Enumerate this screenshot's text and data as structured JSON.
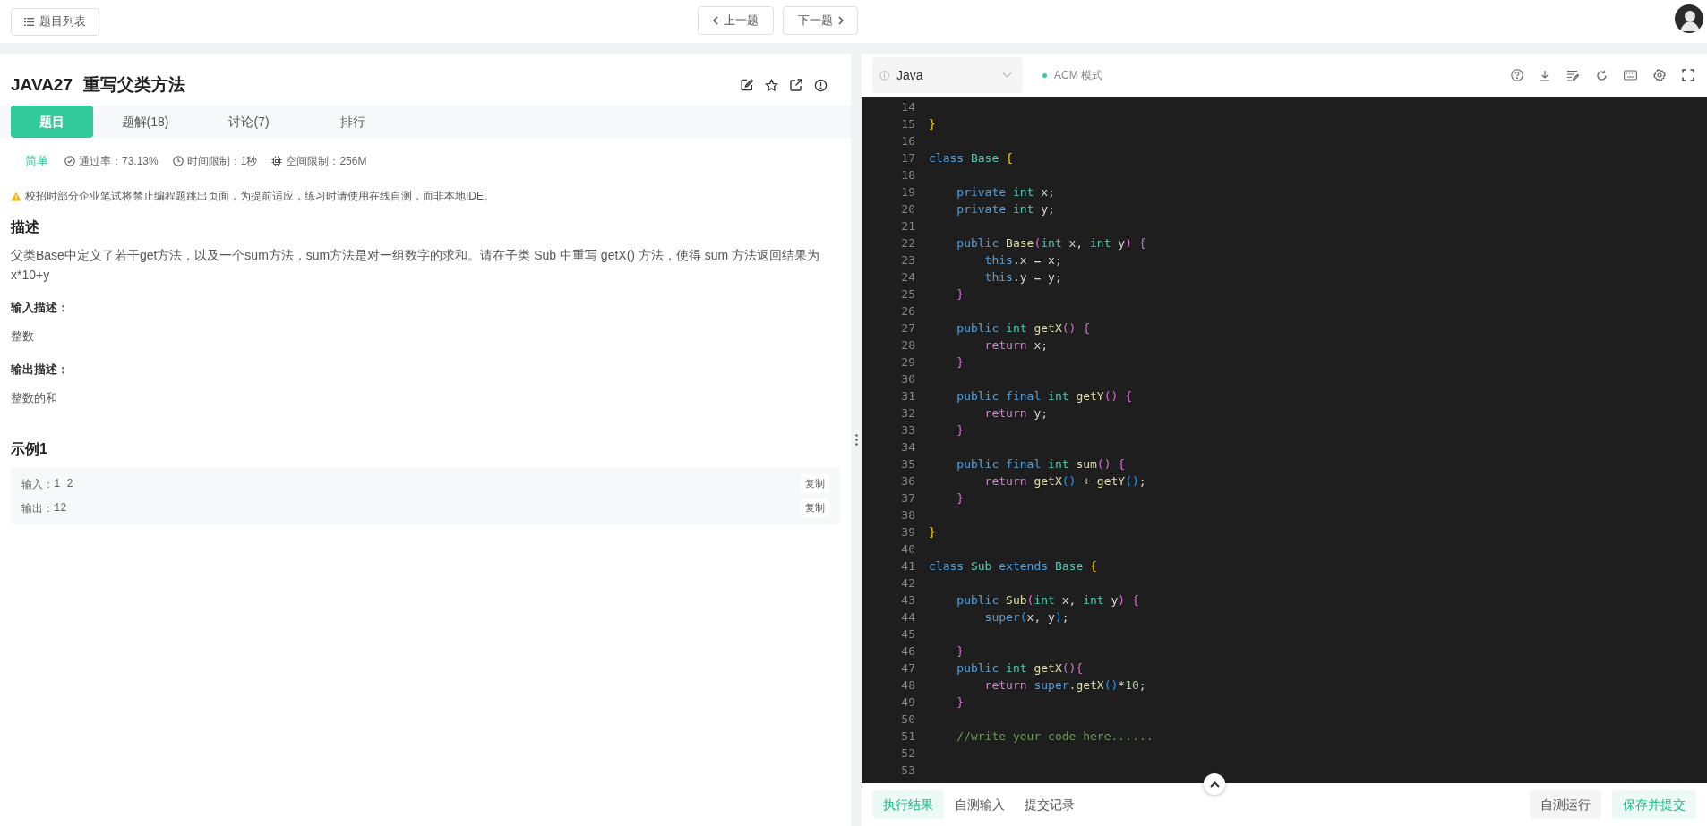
{
  "top_bar": {
    "problem_list_button": "题目列表",
    "prev_button": "上一题",
    "next_button": "下一题"
  },
  "problem": {
    "code": "JAVA27",
    "title": "重写父类方法",
    "tabs": [
      {
        "label": "题目",
        "selected": true
      },
      {
        "label": "题解(18)",
        "selected": false
      },
      {
        "label": "讨论(7)",
        "selected": false
      },
      {
        "label": "排行",
        "selected": false
      }
    ],
    "difficulty": "简单",
    "pass_rate": "通过率：73.13%",
    "time_limit": "时间限制：1秒",
    "memory_limit": "空间限制：256M",
    "notice": "校招时部分企业笔试将禁止编程题跳出页面，为提前适应，练习时请使用在线自测，而非本地IDE。",
    "description": {
      "heading": "描述",
      "text": "父类Base中定义了若干get方法，以及一个sum方法，sum方法是对一组数字的求和。请在子类 Sub 中重写 getX() 方法，使得 sum 方法返回结果为 x*10+y"
    },
    "input_description": {
      "heading": "输入描述：",
      "text": "整数"
    },
    "output_description": {
      "heading": "输出描述：",
      "text": "整数的和"
    },
    "example": {
      "title": "示例1",
      "rows": [
        {
          "label": "输入：",
          "value": "1 2",
          "copy": "复制"
        },
        {
          "label": "输出：",
          "value": "12",
          "copy": "复制"
        }
      ]
    }
  },
  "editor": {
    "language": "Java",
    "mode": "ACM 模式",
    "lines": [
      {
        "number": "14"
      },
      {
        "number": "15",
        "tokens": [
          {
            "kind": "brace1",
            "text": "}"
          }
        ]
      },
      {
        "number": "16"
      },
      {
        "number": "17",
        "tokens": [
          {
            "kind": "keyword",
            "text": "class "
          },
          {
            "kind": "type",
            "text": "Base "
          },
          {
            "kind": "brace1",
            "text": "{"
          }
        ]
      },
      {
        "number": "18"
      },
      {
        "number": "19",
        "tokens": [
          {
            "kind": "keyword",
            "text": "    private "
          },
          {
            "kind": "type",
            "text": "int"
          },
          {
            "kind": "plain",
            "text": " x;"
          }
        ]
      },
      {
        "number": "20",
        "tokens": [
          {
            "kind": "keyword",
            "text": "    private "
          },
          {
            "kind": "type",
            "text": "int"
          },
          {
            "kind": "plain",
            "text": " y;"
          }
        ]
      },
      {
        "number": "21"
      },
      {
        "number": "22",
        "tokens": [
          {
            "kind": "keyword",
            "text": "    public "
          },
          {
            "kind": "func",
            "text": "Base"
          },
          {
            "kind": "brace2",
            "text": "("
          },
          {
            "kind": "type",
            "text": "int"
          },
          {
            "kind": "plain",
            "text": " x, "
          },
          {
            "kind": "type",
            "text": "int"
          },
          {
            "kind": "plain",
            "text": " y"
          },
          {
            "kind": "brace2",
            "text": ") {"
          }
        ]
      },
      {
        "number": "23",
        "tokens": [
          {
            "kind": "keyword",
            "text": "        this"
          },
          {
            "kind": "plain",
            "text": ".x = x;"
          }
        ]
      },
      {
        "number": "24",
        "tokens": [
          {
            "kind": "keyword",
            "text": "        this"
          },
          {
            "kind": "plain",
            "text": ".y = y;"
          }
        ]
      },
      {
        "number": "25",
        "tokens": [
          {
            "kind": "brace2",
            "text": "    }"
          }
        ]
      },
      {
        "number": "26"
      },
      {
        "number": "27",
        "tokens": [
          {
            "kind": "keyword",
            "text": "    public "
          },
          {
            "kind": "type",
            "text": "int "
          },
          {
            "kind": "func",
            "text": "getX"
          },
          {
            "kind": "brace2",
            "text": "() {"
          }
        ]
      },
      {
        "number": "28",
        "tokens": [
          {
            "kind": "control",
            "text": "        return"
          },
          {
            "kind": "plain",
            "text": " x;"
          }
        ]
      },
      {
        "number": "29",
        "tokens": [
          {
            "kind": "brace2",
            "text": "    }"
          }
        ]
      },
      {
        "number": "30"
      },
      {
        "number": "31",
        "tokens": [
          {
            "kind": "keyword",
            "text": "    public final "
          },
          {
            "kind": "type",
            "text": "int "
          },
          {
            "kind": "func",
            "text": "getY"
          },
          {
            "kind": "brace2",
            "text": "() {"
          }
        ]
      },
      {
        "number": "32",
        "tokens": [
          {
            "kind": "control",
            "text": "        return"
          },
          {
            "kind": "plain",
            "text": " y;"
          }
        ]
      },
      {
        "number": "33",
        "tokens": [
          {
            "kind": "brace2",
            "text": "    }"
          }
        ]
      },
      {
        "number": "34"
      },
      {
        "number": "35",
        "tokens": [
          {
            "kind": "keyword",
            "text": "    public final "
          },
          {
            "kind": "type",
            "text": "int "
          },
          {
            "kind": "func",
            "text": "sum"
          },
          {
            "kind": "brace2",
            "text": "() {"
          }
        ]
      },
      {
        "number": "36",
        "tokens": [
          {
            "kind": "control",
            "text": "        return "
          },
          {
            "kind": "func",
            "text": "getX"
          },
          {
            "kind": "brace3",
            "text": "()"
          },
          {
            "kind": "plain",
            "text": " + "
          },
          {
            "kind": "func",
            "text": "getY"
          },
          {
            "kind": "brace3",
            "text": "()"
          },
          {
            "kind": "plain",
            "text": ";"
          }
        ]
      },
      {
        "number": "37",
        "tokens": [
          {
            "kind": "brace2",
            "text": "    }"
          }
        ]
      },
      {
        "number": "38"
      },
      {
        "number": "39",
        "tokens": [
          {
            "kind": "brace1",
            "text": "}"
          }
        ]
      },
      {
        "number": "40"
      },
      {
        "number": "41",
        "tokens": [
          {
            "kind": "keyword",
            "text": "class "
          },
          {
            "kind": "type",
            "text": "Sub "
          },
          {
            "kind": "keyword",
            "text": "extends "
          },
          {
            "kind": "type",
            "text": "Base "
          },
          {
            "kind": "brace1",
            "text": "{"
          }
        ]
      },
      {
        "number": "42"
      },
      {
        "number": "43",
        "tokens": [
          {
            "kind": "keyword",
            "text": "    public "
          },
          {
            "kind": "func",
            "text": "Sub"
          },
          {
            "kind": "brace2",
            "text": "("
          },
          {
            "kind": "type",
            "text": "int"
          },
          {
            "kind": "plain",
            "text": " x, "
          },
          {
            "kind": "type",
            "text": "int"
          },
          {
            "kind": "plain",
            "text": " y"
          },
          {
            "kind": "brace2",
            "text": ") {"
          }
        ]
      },
      {
        "number": "44",
        "tokens": [
          {
            "kind": "keyword",
            "text": "        super"
          },
          {
            "kind": "brace3",
            "text": "("
          },
          {
            "kind": "plain",
            "text": "x, y"
          },
          {
            "kind": "brace3",
            "text": ")"
          },
          {
            "kind": "plain",
            "text": ";"
          }
        ]
      },
      {
        "number": "45"
      },
      {
        "number": "46",
        "tokens": [
          {
            "kind": "brace2",
            "text": "    }"
          }
        ]
      },
      {
        "number": "47",
        "tokens": [
          {
            "kind": "keyword",
            "text": "    public "
          },
          {
            "kind": "type",
            "text": "int "
          },
          {
            "kind": "func",
            "text": "getX"
          },
          {
            "kind": "brace2",
            "text": "(){"
          }
        ]
      },
      {
        "number": "48",
        "tokens": [
          {
            "kind": "control",
            "text": "        return "
          },
          {
            "kind": "keyword",
            "text": "super"
          },
          {
            "kind": "plain",
            "text": "."
          },
          {
            "kind": "func",
            "text": "getX"
          },
          {
            "kind": "brace3",
            "text": "()"
          },
          {
            "kind": "plain",
            "text": "*"
          },
          {
            "kind": "number",
            "text": "10"
          },
          {
            "kind": "plain",
            "text": ";"
          }
        ]
      },
      {
        "number": "49",
        "tokens": [
          {
            "kind": "brace2",
            "text": "    }"
          }
        ]
      },
      {
        "number": "50"
      },
      {
        "number": "51",
        "tokens": [
          {
            "kind": "comment",
            "text": "    //write your code here......"
          }
        ]
      },
      {
        "number": "52"
      },
      {
        "number": "53"
      }
    ],
    "bottom_tabs": [
      {
        "label": "执行结果",
        "selected": true
      },
      {
        "label": "自测输入",
        "selected": false
      },
      {
        "label": "提交记录",
        "selected": false
      }
    ],
    "buttons": [
      {
        "label": "自测运行",
        "kind": "secondary"
      },
      {
        "label": "保存并提交",
        "kind": "primary"
      }
    ]
  }
}
